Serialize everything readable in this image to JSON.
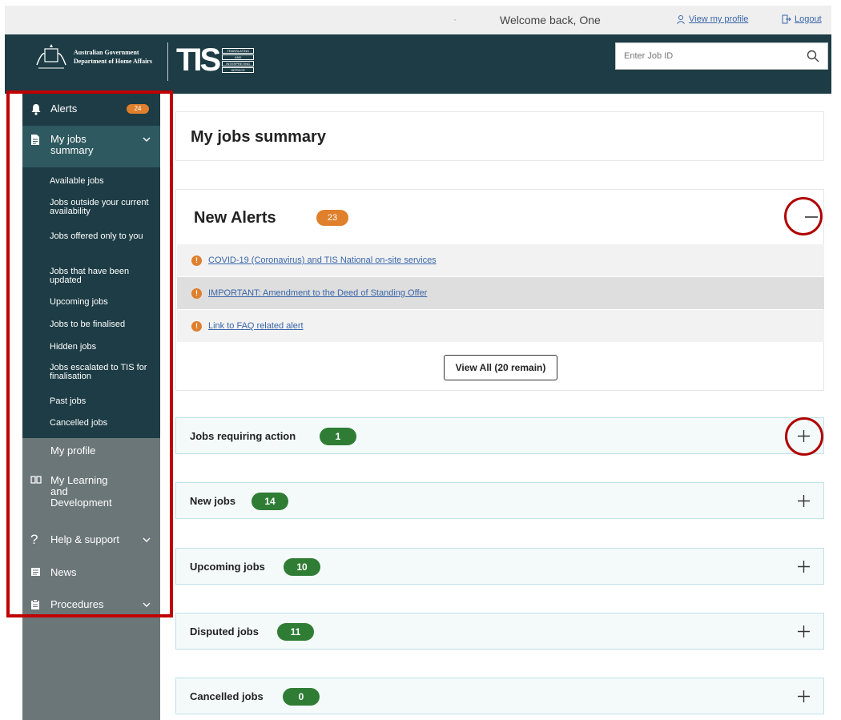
{
  "topbar": {
    "welcome": "Welcome back, One",
    "view_profile": "View my profile",
    "logout": "Logout"
  },
  "header": {
    "gov_line1": "Australian Government",
    "gov_line2": "Department of Home Affairs",
    "tis_mark": "TIS",
    "tis_sub": [
      "TRANSLATING",
      "AND",
      "INTERPRETING",
      "SERVICE"
    ],
    "search_placeholder": "Enter Job ID"
  },
  "sidebar": {
    "alerts": {
      "label": "Alerts",
      "count": "24"
    },
    "my_jobs_summary": "My jobs summary",
    "sub_items": [
      "Available jobs",
      "Jobs outside your current availability",
      "Jobs offered only to you",
      "Jobs that have been updated",
      "Upcoming jobs",
      "Jobs to be finalised",
      "Hidden jobs",
      "Jobs escalated to TIS for finalisation",
      "Past jobs",
      "Cancelled jobs"
    ],
    "my_profile": "My profile",
    "learning": "My Learning and Development",
    "help": "Help & support",
    "news": "News",
    "procedures": "Procedures"
  },
  "main": {
    "title": "My jobs summary",
    "alerts_title": "New Alerts",
    "alerts_count": "23",
    "alert_links": [
      "COVID-19 (Coronavirus) and TIS National on-site services",
      "IMPORTANT: Amendment to the Deed of Standing Offer",
      "Link to FAQ related alert"
    ],
    "view_all": "View All (20 remain)",
    "sections": [
      {
        "title": "Jobs requiring action",
        "count": "1"
      },
      {
        "title": "New jobs",
        "count": "14"
      },
      {
        "title": "Upcoming jobs",
        "count": "10"
      },
      {
        "title": "Disputed jobs",
        "count": "11"
      },
      {
        "title": "Cancelled jobs",
        "count": "0"
      }
    ]
  },
  "colors": {
    "header": "#1d3c45",
    "sidebar": "#6b7678",
    "orange_badge": "#e07f2c",
    "green_badge": "#2f7d34",
    "highlight_red": "#c00000"
  }
}
